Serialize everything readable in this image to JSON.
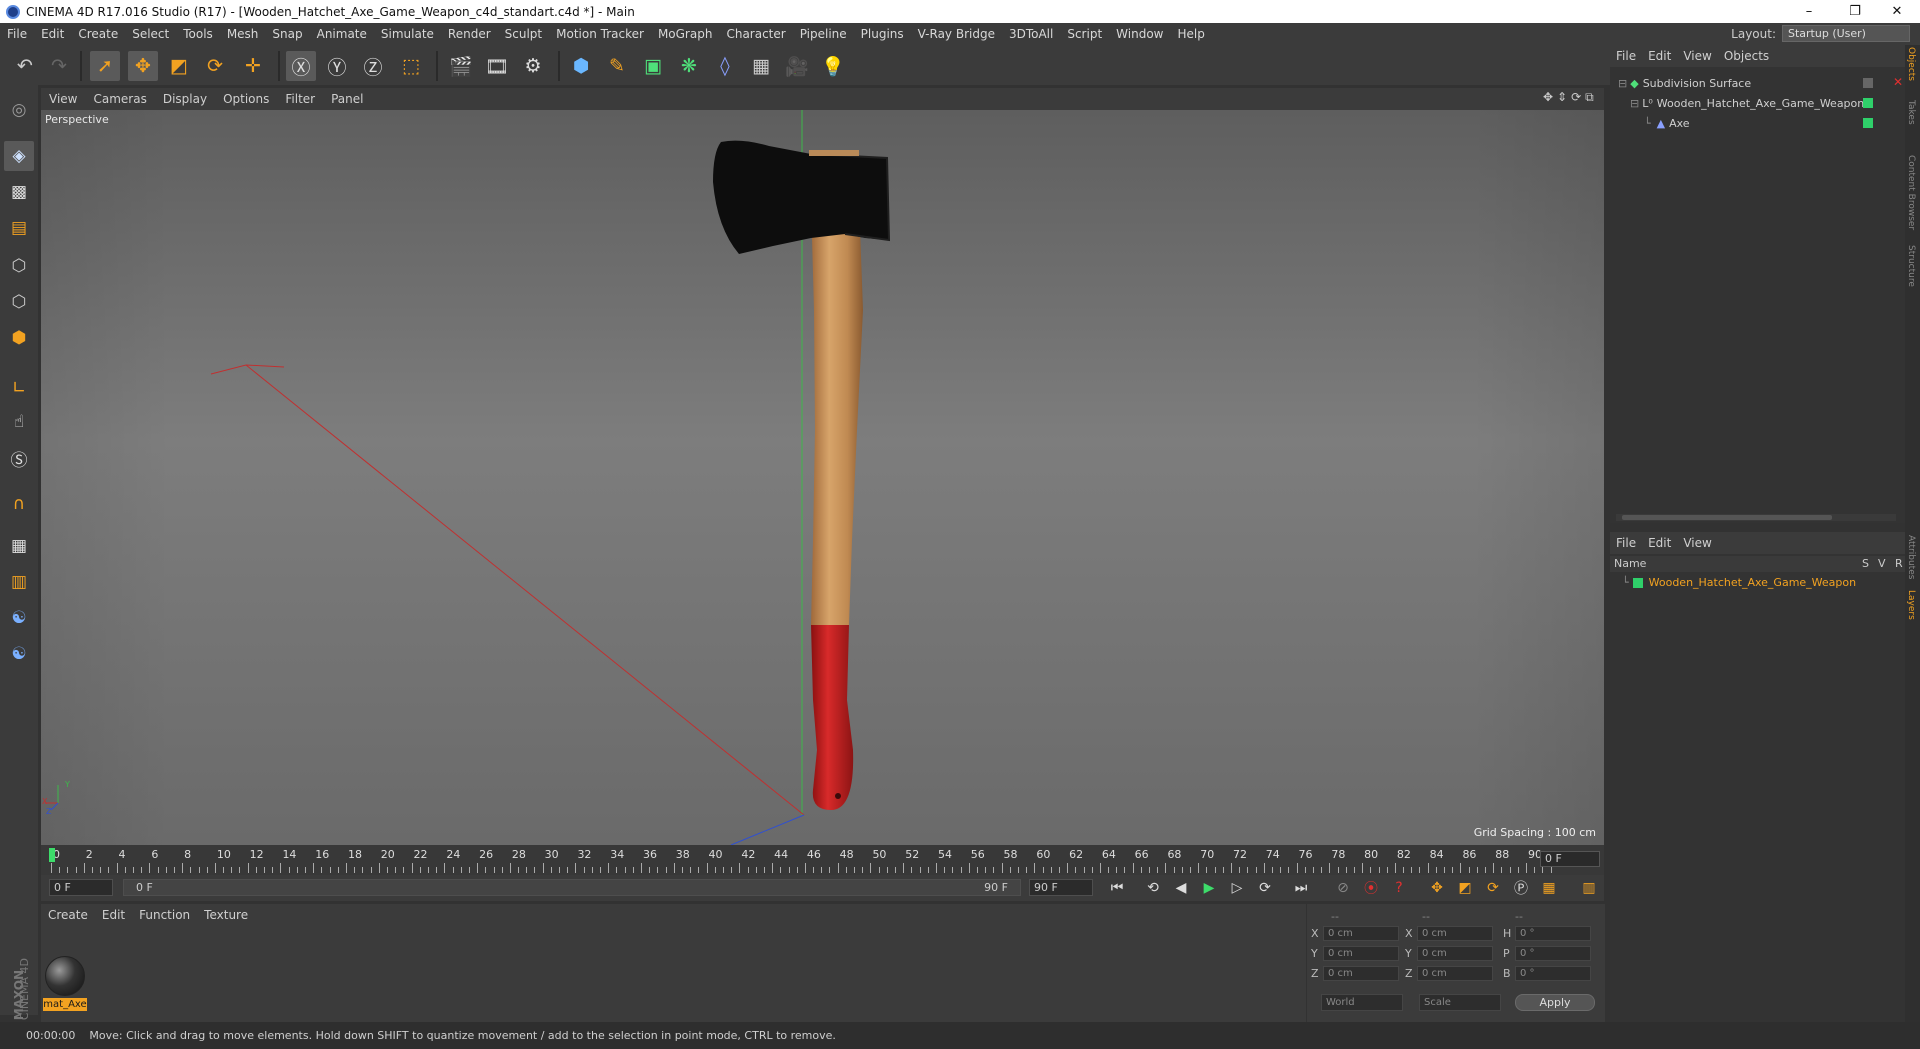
{
  "window": {
    "title": "CINEMA 4D R17.016 Studio (R17) - [Wooden_Hatchet_Axe_Game_Weapon_c4d_standart.c4d *] - Main",
    "controls": [
      "–",
      "❐",
      "✕"
    ]
  },
  "menubar": {
    "items": [
      "File",
      "Edit",
      "Create",
      "Select",
      "Tools",
      "Mesh",
      "Snap",
      "Animate",
      "Simulate",
      "Render",
      "Sculpt",
      "Motion Tracker",
      "MoGraph",
      "Character",
      "Pipeline",
      "Plugins",
      "V-Ray Bridge",
      "3DToAll",
      "Script",
      "Window",
      "Help"
    ],
    "layout_label": "Layout:",
    "layout_value": "Startup (User)"
  },
  "viewport": {
    "menu": [
      "View",
      "Cameras",
      "Display",
      "Options",
      "Filter",
      "Panel"
    ],
    "label": "Perspective",
    "grid_spacing": "Grid Spacing : 100 cm",
    "axis_y": "Y",
    "axis_x": "X",
    "axis_z": "Z"
  },
  "timeline": {
    "ticks": [
      "0",
      "2",
      "4",
      "6",
      "8",
      "10",
      "12",
      "14",
      "16",
      "18",
      "20",
      "22",
      "24",
      "26",
      "28",
      "30",
      "32",
      "34",
      "36",
      "38",
      "40",
      "42",
      "44",
      "46",
      "48",
      "50",
      "52",
      "54",
      "56",
      "58",
      "60",
      "62",
      "64",
      "66",
      "68",
      "70",
      "72",
      "74",
      "76",
      "78",
      "80",
      "82",
      "84",
      "86",
      "88",
      "90"
    ],
    "current_frame": "0 F"
  },
  "transport": {
    "start": "0 F",
    "range_start": "0 F",
    "range_end": "90 F",
    "end": "90 F"
  },
  "materials": {
    "menu": [
      "Create",
      "Edit",
      "Function",
      "Texture"
    ],
    "items": [
      {
        "name": "mat_Axe"
      }
    ],
    "brand_top": "MAXON",
    "brand_bottom": "CINEMA 4D"
  },
  "coords": {
    "header": [
      "--",
      "--",
      "--"
    ],
    "rows": [
      {
        "a": "X",
        "av": "0 cm",
        "b": "X",
        "bv": "0 cm",
        "c": "H",
        "cv": "0 °"
      },
      {
        "a": "Y",
        "av": "0 cm",
        "b": "Y",
        "bv": "0 cm",
        "c": "P",
        "cv": "0 °"
      },
      {
        "a": "Z",
        "av": "0 cm",
        "b": "Z",
        "bv": "0 cm",
        "c": "B",
        "cv": "0 °"
      }
    ],
    "space": "World",
    "mode": "Scale",
    "apply": "Apply"
  },
  "objects_panel": {
    "menu": [
      "File",
      "Edit",
      "View",
      "Objects"
    ],
    "tree": [
      {
        "name": "Subdivision Surface",
        "level": 0
      },
      {
        "name": "Wooden_Hatchet_Axe_Game_Weapon",
        "level": 1
      },
      {
        "name": "Axe",
        "level": 2
      }
    ]
  },
  "layers_panel": {
    "menu": [
      "File",
      "Edit",
      "View"
    ],
    "header_name": "Name",
    "header_flags": [
      "S",
      "V",
      "R"
    ],
    "layers": [
      {
        "name": "Wooden_Hatchet_Axe_Game_Weapon"
      }
    ]
  },
  "side_tabs": [
    "Objects",
    "Takes",
    "Content Browser",
    "Structure",
    "Attributes",
    "Layers"
  ],
  "status": {
    "time": "00:00:00",
    "message": "Move: Click and drag to move elements. Hold down SHIFT to quantize movement / add to the selection in point mode, CTRL to remove."
  },
  "colors": {
    "accent": "#f2a221",
    "layer_green": "#2fd06a",
    "background": "#323232"
  }
}
